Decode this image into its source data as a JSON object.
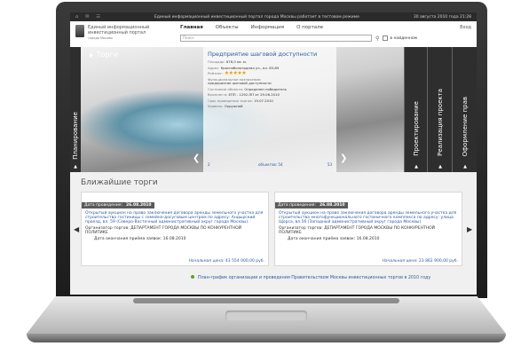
{
  "topbar": {
    "message": "Единый информационный инвестиционный портал города Москвы работает в тестовом режиме",
    "datetime": "30 августа 2010 года 21:28"
  },
  "header": {
    "logo_line1": "Единый информационный",
    "logo_line2": "инвестиционный портал",
    "logo_line3": "города Москвы",
    "nav": [
      "Главная",
      "Объекты",
      "Информация",
      "О портале"
    ],
    "search_placeholder": "Поиск",
    "found_label": "в найденном",
    "login": "Вход"
  },
  "hero": {
    "title": "Торги",
    "left_tab": "Планирование",
    "right_tabs": [
      "Проектирование",
      "Реализация проекта",
      "Оформление прав"
    ],
    "counter_left": "2",
    "counter_mid": "объектов: 54",
    "counter_right": "53",
    "info": {
      "title": "Предприятие шаговой доступности",
      "area_label": "Площадь:",
      "area_value": "876,0 кв. м.",
      "address_label": "Адрес:",
      "address_value": "Красноболотрдная ул., вл. 83-89",
      "rating_label": "Рейтинг:",
      "stars": "★★★★★",
      "function_label": "Функциональное назначение:",
      "function_value": "предприятие шаговой доступности",
      "state_label": "Состояние объекта:",
      "state_value": "Определен победитель",
      "included_label": "Включен в:",
      "included_value": "ЕПП - 1292-ПП от 29.06.2010",
      "deadline_label": "Срок проведения торгов:",
      "deadline_value": "19.07.2010",
      "level_label": "Уровень:",
      "level_value": "Окружной"
    }
  },
  "auctions": {
    "title": "Ближайшие торги",
    "items": [
      {
        "date_label": "Дата проведения:",
        "date": "26.08.2010",
        "desc": "Открытый аукцион на право заключения договора аренды земельного участка для строительства гостиницы с семейно-досуговым центром по адресу: Андырский проезд, вл. 59 (Северо-Восточный административный округ города Москвы)",
        "org": "Организатор торгов: ДЕПАРТАМЕНТ ГОРОДА МОСКВЫ ПО КОНКУРЕНТНОЙ ПОЛИТИКЕ",
        "end": "Дата окончания приёма заявок:    16.08.2010",
        "price": "Начальная цена: 43 554 000,00 руб."
      },
      {
        "date_label": "Дата проведения:",
        "date": "26.08.2010",
        "desc": "Открытый аукцион на право заключения договора аренды земельного участка для строительства многофункционального гостиничного комплекса по адресу: улица Щорса, вл.56 (Западный административный округ города Москвы)",
        "org": "Организатор торгов: ДЕПАРТАМЕНТ ГОРОДА МОСКВЫ ПО КОНКУРЕНТНОЙ ПОЛИТИКЕ",
        "end": "Дата окончания приёма заявок:    16.08.2010",
        "price": "Начальная цена: 23 862 900,00 руб."
      }
    ],
    "plan_link": "План-график организации и проведения Правительством Москвы инвестиционных торгов в 2010 году"
  }
}
